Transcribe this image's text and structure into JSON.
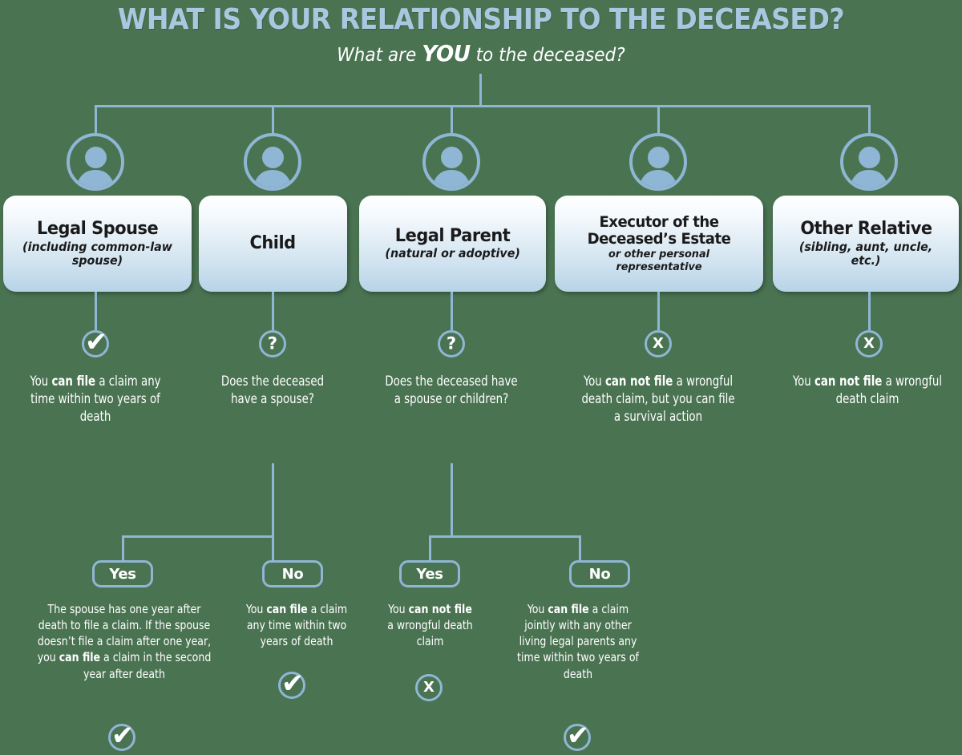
{
  "header": {
    "title": "WHAT IS YOUR RELATIONSHIP TO THE DECEASED?",
    "subtitle_before": "What are ",
    "subtitle_emphasis": "YOU",
    "subtitle_after": " to the deceased?",
    "title_color": "#a9c8e0",
    "background_color": "#4a7352",
    "accent_color": "#8fb6d4"
  },
  "branches": [
    {
      "id": "legal-spouse",
      "avatar_icon": "person-avatar-icon",
      "box_title": "Legal Spouse",
      "box_subtitle": "(including common-law spouse)",
      "badge_icon": "check-icon",
      "badge_glyph": "✔",
      "result_text_html": "You <b>can file</b> a claim any time within two years of death"
    },
    {
      "id": "child",
      "avatar_icon": "person-avatar-icon",
      "box_title": "Child",
      "box_subtitle": "",
      "badge_icon": "question-icon",
      "badge_glyph": "?",
      "result_text_html": "Does the deceased have a spouse?"
    },
    {
      "id": "legal-parent",
      "avatar_icon": "person-avatar-icon",
      "box_title": "Legal Parent",
      "box_subtitle": "(natural or adoptive)",
      "badge_icon": "question-icon",
      "badge_glyph": "?",
      "result_text_html": "Does the deceased have a spouse or children?"
    },
    {
      "id": "executor",
      "avatar_icon": "person-avatar-icon",
      "box_title": "Executor of the Deceased’s Estate",
      "box_subtitle": "or other personal representative",
      "badge_icon": "x-icon",
      "badge_glyph": "X",
      "result_text_html": "You <b>can not file</b> a wrongful death claim, but you can file a survival action"
    },
    {
      "id": "other-relative",
      "avatar_icon": "person-avatar-icon",
      "box_title": "Other Relative",
      "box_subtitle": "(sibling, aunt, uncle, etc.)",
      "badge_icon": "x-icon",
      "badge_glyph": "X",
      "result_text_html": "You <b>can not file</b> a wrongful death claim"
    }
  ],
  "outcomes": [
    {
      "id": "child-yes",
      "parent": "child",
      "pill_label": "Yes",
      "text_html": "The spouse has one year after death to file a claim. If the spouse doesn’t file a claim after one year, you <b>can file</b> a claim in the second year after death",
      "badge_icon": "check-icon",
      "badge_glyph": "✔"
    },
    {
      "id": "child-no",
      "parent": "child",
      "pill_label": "No",
      "text_html": "You <b>can file</b> a claim any time within two years of death",
      "badge_icon": "check-icon",
      "badge_glyph": "✔"
    },
    {
      "id": "parent-yes",
      "parent": "legal-parent",
      "pill_label": "Yes",
      "text_html": "You <b>can not file</b> a wrongful death claim",
      "badge_icon": "x-icon",
      "badge_glyph": "X"
    },
    {
      "id": "parent-no",
      "parent": "legal-parent",
      "pill_label": "No",
      "text_html": "You <b>can file</b> a claim jointly with any other living legal parents any time within two years of death",
      "badge_icon": "check-icon",
      "badge_glyph": "✔"
    }
  ]
}
